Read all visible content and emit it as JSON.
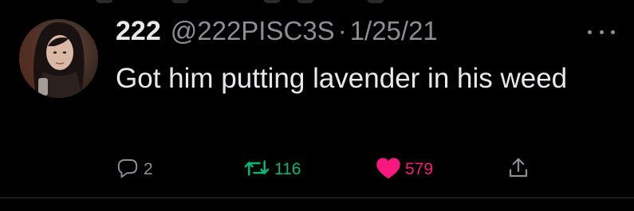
{
  "tweet": {
    "display_name": "222",
    "handle": "@222PISC3S",
    "separator": "·",
    "date": "1/25/21",
    "text": "Got him putting lavender in his weed",
    "actions": {
      "replies": "2",
      "retweets": "116",
      "likes": "579"
    }
  },
  "icons": {
    "reply": "reply-icon",
    "retweet": "retweet-icon",
    "like": "heart-icon",
    "share": "share-icon",
    "more": "more-icon"
  },
  "colors": {
    "background": "#000000",
    "text": "#e7e9ea",
    "muted": "#8b8f94",
    "retweet": "#00ba7c",
    "like": "#f91880",
    "divider": "#2f3336"
  }
}
